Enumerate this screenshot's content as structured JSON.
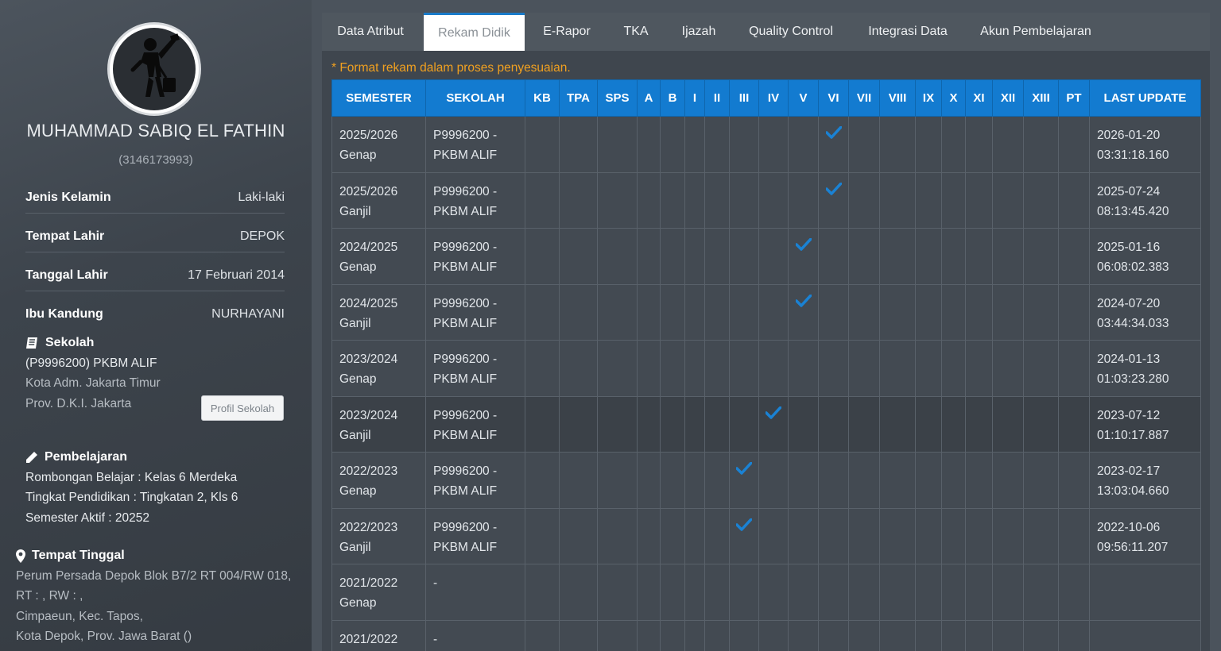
{
  "profile": {
    "name": "MUHAMMAD SABIQ EL FATHIN",
    "nisn": "(3146173993)",
    "fields": [
      {
        "label": "Jenis Kelamin",
        "value": "Laki-laki"
      },
      {
        "label": "Tempat Lahir",
        "value": "DEPOK"
      },
      {
        "label": "Tanggal Lahir",
        "value": "17 Februari 2014"
      },
      {
        "label": "Ibu Kandung",
        "value": "NURHAYANI"
      }
    ],
    "sekolah": {
      "title": "Sekolah",
      "name": "(P9996200) PKBM ALIF",
      "kota": "Kota Adm. Jakarta Timur",
      "prov": "Prov. D.K.I. Jakarta",
      "button": "Profil Sekolah"
    },
    "pembelajaran": {
      "title": "Pembelajaran",
      "rombel": "Rombongan Belajar : Kelas 6 Merdeka",
      "tingkat": "Tingkat Pendidikan : Tingkatan 2, Kls 6",
      "semester": "Semester Aktif : 20252"
    },
    "tempat_tinggal": {
      "title": "Tempat Tinggal",
      "line1": "Perum Persada Depok Blok B7/2 RT 004/RW 018,",
      "line2": "RT : , RW : ,",
      "line3": "Cimpaeun, Kec. Tapos,",
      "line4": "Kota Depok, Prov. Jawa Barat ()"
    }
  },
  "tabs": [
    "Data Atribut",
    "Rekam Didik",
    "E-Rapor",
    "TKA",
    "Ijazah",
    "Quality Control",
    "Integrasi Data",
    "Akun Pembelajaran"
  ],
  "active_tab": "Rekam Didik",
  "notice": "* Format rekam dalam proses penyesuaian.",
  "table": {
    "columns": [
      "SEMESTER",
      "SEKOLAH",
      "KB",
      "TPA",
      "SPS",
      "A",
      "B",
      "I",
      "II",
      "III",
      "IV",
      "V",
      "VI",
      "VII",
      "VIII",
      "IX",
      "X",
      "XI",
      "XII",
      "XIII",
      "PT",
      "LAST UPDATE"
    ],
    "rows": [
      {
        "semester": "2025/2026\nGenap",
        "sekolah": "P9996200 -\nPKBM ALIF",
        "level": "VI",
        "updated": "2026-01-20\n03:31:18.160"
      },
      {
        "semester": "2025/2026\nGanjil",
        "sekolah": "P9996200 -\nPKBM ALIF",
        "level": "VI",
        "updated": "2025-07-24\n08:13:45.420"
      },
      {
        "semester": "2024/2025\nGenap",
        "sekolah": "P9996200 -\nPKBM ALIF",
        "level": "V",
        "updated": "2025-01-16\n06:08:02.383"
      },
      {
        "semester": "2024/2025\nGanjil",
        "sekolah": "P9996200 -\nPKBM ALIF",
        "level": "V",
        "updated": "2024-07-20\n03:44:34.033"
      },
      {
        "semester": "2023/2024\nGenap",
        "sekolah": "P9996200 -\nPKBM ALIF",
        "level": "",
        "updated": "2024-01-13\n01:03:23.280"
      },
      {
        "semester": "2023/2024\nGanjil",
        "sekolah": "P9996200 -\nPKBM ALIF",
        "level": "IV",
        "updated": "2023-07-12\n01:10:17.887",
        "highlight": true
      },
      {
        "semester": "2022/2023\nGenap",
        "sekolah": "P9996200 -\nPKBM ALIF",
        "level": "III",
        "updated": "2023-02-17\n13:03:04.660"
      },
      {
        "semester": "2022/2023\nGanjil",
        "sekolah": "P9996200 -\nPKBM ALIF",
        "level": "III",
        "updated": "2022-10-06\n09:56:11.207"
      },
      {
        "semester": "2021/2022\nGenap",
        "sekolah": "-",
        "level": "",
        "updated": ""
      },
      {
        "semester": "2021/2022",
        "sekolah": "-",
        "level": "",
        "updated": ""
      }
    ]
  },
  "colors": {
    "header_blue": "#137bd0",
    "check_blue": "#1a82d4",
    "notice_orange": "#f0a020"
  },
  "icons": {
    "check": "check-icon",
    "book": "book-icon",
    "pencil": "pencil-icon",
    "pin": "map-pin-icon"
  }
}
